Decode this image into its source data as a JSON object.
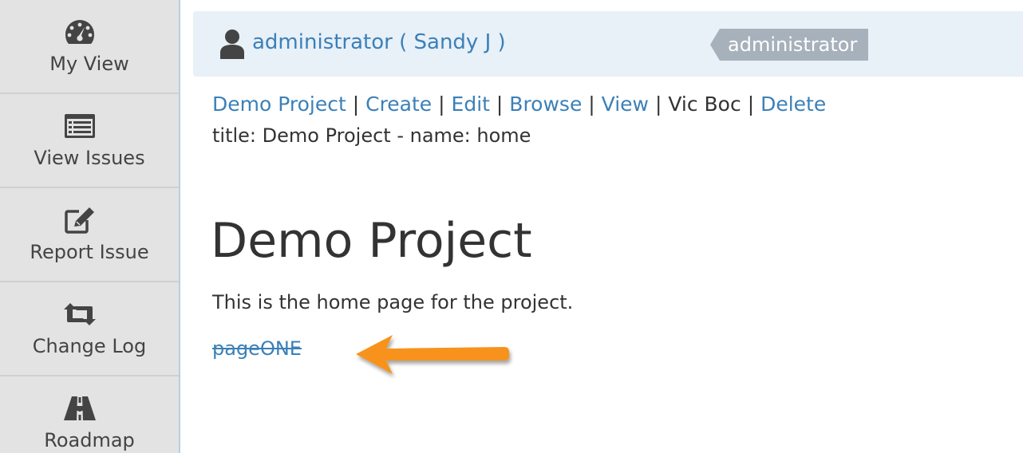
{
  "sidebar": {
    "items": [
      {
        "label": "My View",
        "icon": "dashboard-icon"
      },
      {
        "label": "View Issues",
        "icon": "list-icon"
      },
      {
        "label": "Report Issue",
        "icon": "edit-icon"
      },
      {
        "label": "Change Log",
        "icon": "retweet-icon"
      },
      {
        "label": "Roadmap",
        "icon": "road-icon"
      }
    ]
  },
  "userbar": {
    "user_text": "administrator ( Sandy J )",
    "role": "administrator",
    "icon": "user-icon"
  },
  "wiki": {
    "links": {
      "project": "Demo Project",
      "create": "Create",
      "edit": "Edit",
      "browse": "Browse",
      "view": "View",
      "author": "Vic Boc",
      "delete": "Delete"
    },
    "separator": "|",
    "title_line": "title: Demo Project - name: home"
  },
  "content": {
    "heading": "Demo Project",
    "description": "This is the home page for the project.",
    "link": "pageONE"
  },
  "colors": {
    "link": "#3b80b8",
    "sidebar_bg": "#e3e3e3",
    "userbar_bg": "#e8f0f8",
    "badge_bg": "#a7b1bb",
    "arrow": "#f7931e"
  }
}
